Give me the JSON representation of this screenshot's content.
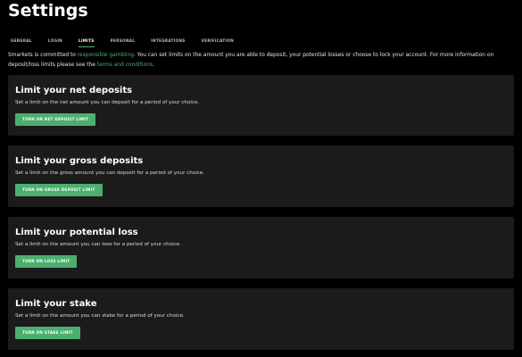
{
  "page": {
    "title": "Settings"
  },
  "tabs": [
    {
      "label": "GENERAL",
      "active": false
    },
    {
      "label": "LOGIN",
      "active": false
    },
    {
      "label": "LIMITS",
      "active": true
    },
    {
      "label": "PERSONAL",
      "active": false
    },
    {
      "label": "INTEGRATIONS",
      "active": false
    },
    {
      "label": "VERIFICATION",
      "active": false
    }
  ],
  "intro": {
    "text_before_link": "Smarkets is committed to ",
    "responsible_gambling_link": "responsible gambling",
    "text_middle": ". You can set limits on the amount you are able to deposit, your potential losses or choose to lock your account. For more information on deposit/loss limits please see the ",
    "terms_link": "terms and conditions",
    "text_after": "."
  },
  "cards": [
    {
      "title": "Limit your net deposits",
      "description": "Set a limit on the net amount you can deposit for a period of your choice.",
      "button_label": "TURN ON NET DEPOSIT LIMIT"
    },
    {
      "title": "Limit your gross deposits",
      "description": "Set a limit on the gross amount you can deposit for a period of your choice.",
      "button_label": "TURN ON GROSS DEPOSIT LIMIT"
    },
    {
      "title": "Limit your potential loss",
      "description": "Set a limit on the amount you can lose for a period of your choice.",
      "button_label": "TURN ON LOSS LIMIT"
    },
    {
      "title": "Limit your stake",
      "description": "Set a limit on the amount you can stake for a period of your choice.",
      "button_label": "TURN ON STAKE LIMIT"
    }
  ],
  "colors": {
    "background": "#000000",
    "card_background": "#1b1b1b",
    "accent_green": "#4caf6e",
    "text_primary": "#ffffff",
    "text_secondary": "#dcdcdc"
  }
}
